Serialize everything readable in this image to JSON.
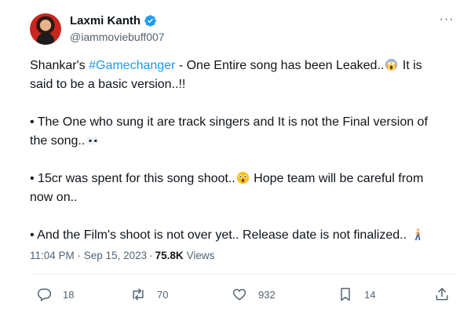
{
  "author": {
    "display_name": "Laxmi Kanth",
    "handle": "@iammoviebuff007",
    "verified": true
  },
  "tweet": {
    "p1_pre": "Shankar's ",
    "p1_hashtag": "#Gamechanger",
    "p1_mid": " - One Entire song has been Leaked..",
    "p1_post": " It is said to be a basic version..!!",
    "p2": "• The One who sung it are track singers and It is not the Final version of the song..",
    "p3_pre": "• 15cr was spent for this song shoot..",
    "p3_post": " Hope team will be careful from now on..",
    "p4": "• And the Film's shoot is not over yet.. Release date is not finalized.. ",
    "emojis": [
      "screaming-face",
      "eyes",
      "astonished-face",
      "person-walking"
    ]
  },
  "meta": {
    "timestamp": "11:04 PM · Sep 15, 2023",
    "separator": "·",
    "views_count": "75.8K",
    "views_label": "Views"
  },
  "actions": {
    "replies": "18",
    "reposts": "70",
    "likes": "932",
    "bookmarks": "14"
  },
  "colors": {
    "accent": "#1d9bf0",
    "text": "#0f1419",
    "secondary": "#536471",
    "divider": "#eff3f4"
  },
  "icons": [
    "verified-badge-icon",
    "more-icon",
    "reply-icon",
    "repost-icon",
    "like-icon",
    "bookmark-icon",
    "share-icon"
  ]
}
